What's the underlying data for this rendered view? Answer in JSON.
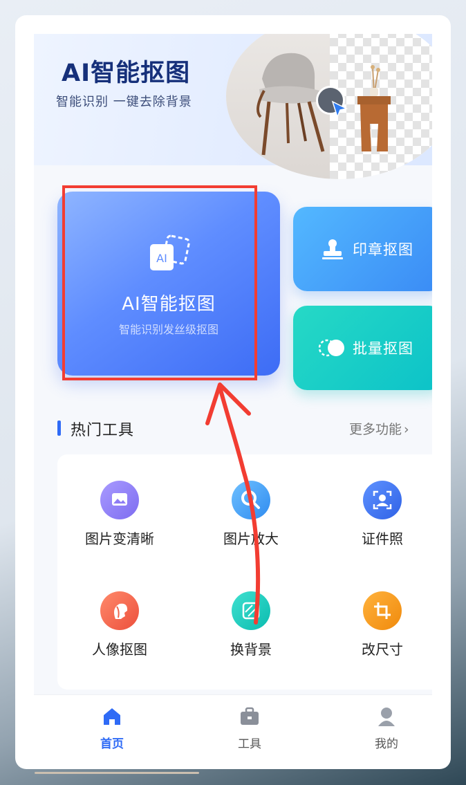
{
  "banner": {
    "title": "AI智能抠图",
    "subtitle": "智能识别 一键去除背景"
  },
  "tiles": {
    "ai": {
      "title": "AI智能抠图",
      "subtitle": "智能识别发丝级抠图",
      "icon_text": "AI"
    },
    "stamp": {
      "label": "印章抠图",
      "icon": "stamp-icon"
    },
    "batch": {
      "label": "批量抠图",
      "icon": "toggle-icon"
    }
  },
  "hot_tools": {
    "title": "热门工具",
    "more": "更多功能",
    "items": [
      {
        "label": "图片变清晰",
        "icon": "image-icon",
        "color": "#8e7cf5"
      },
      {
        "label": "图片放大",
        "icon": "magnifier-icon",
        "color": "#3b9cf5"
      },
      {
        "label": "证件照",
        "icon": "id-photo-icon",
        "color": "#3d72ee"
      },
      {
        "label": "人像抠图",
        "icon": "portrait-icon",
        "color": "#f0654b"
      },
      {
        "label": "换背景",
        "icon": "background-swap-icon",
        "color": "#14c6b7"
      },
      {
        "label": "改尺寸",
        "icon": "crop-icon",
        "color": "#f59a13"
      }
    ]
  },
  "nav": {
    "items": [
      {
        "label": "首页",
        "icon": "home-icon",
        "active": true
      },
      {
        "label": "工具",
        "icon": "toolbox-icon",
        "active": false
      },
      {
        "label": "我的",
        "icon": "profile-icon",
        "active": false
      }
    ]
  },
  "colors": {
    "accent": "#2f6bf6",
    "annotation": "#f23d32"
  }
}
